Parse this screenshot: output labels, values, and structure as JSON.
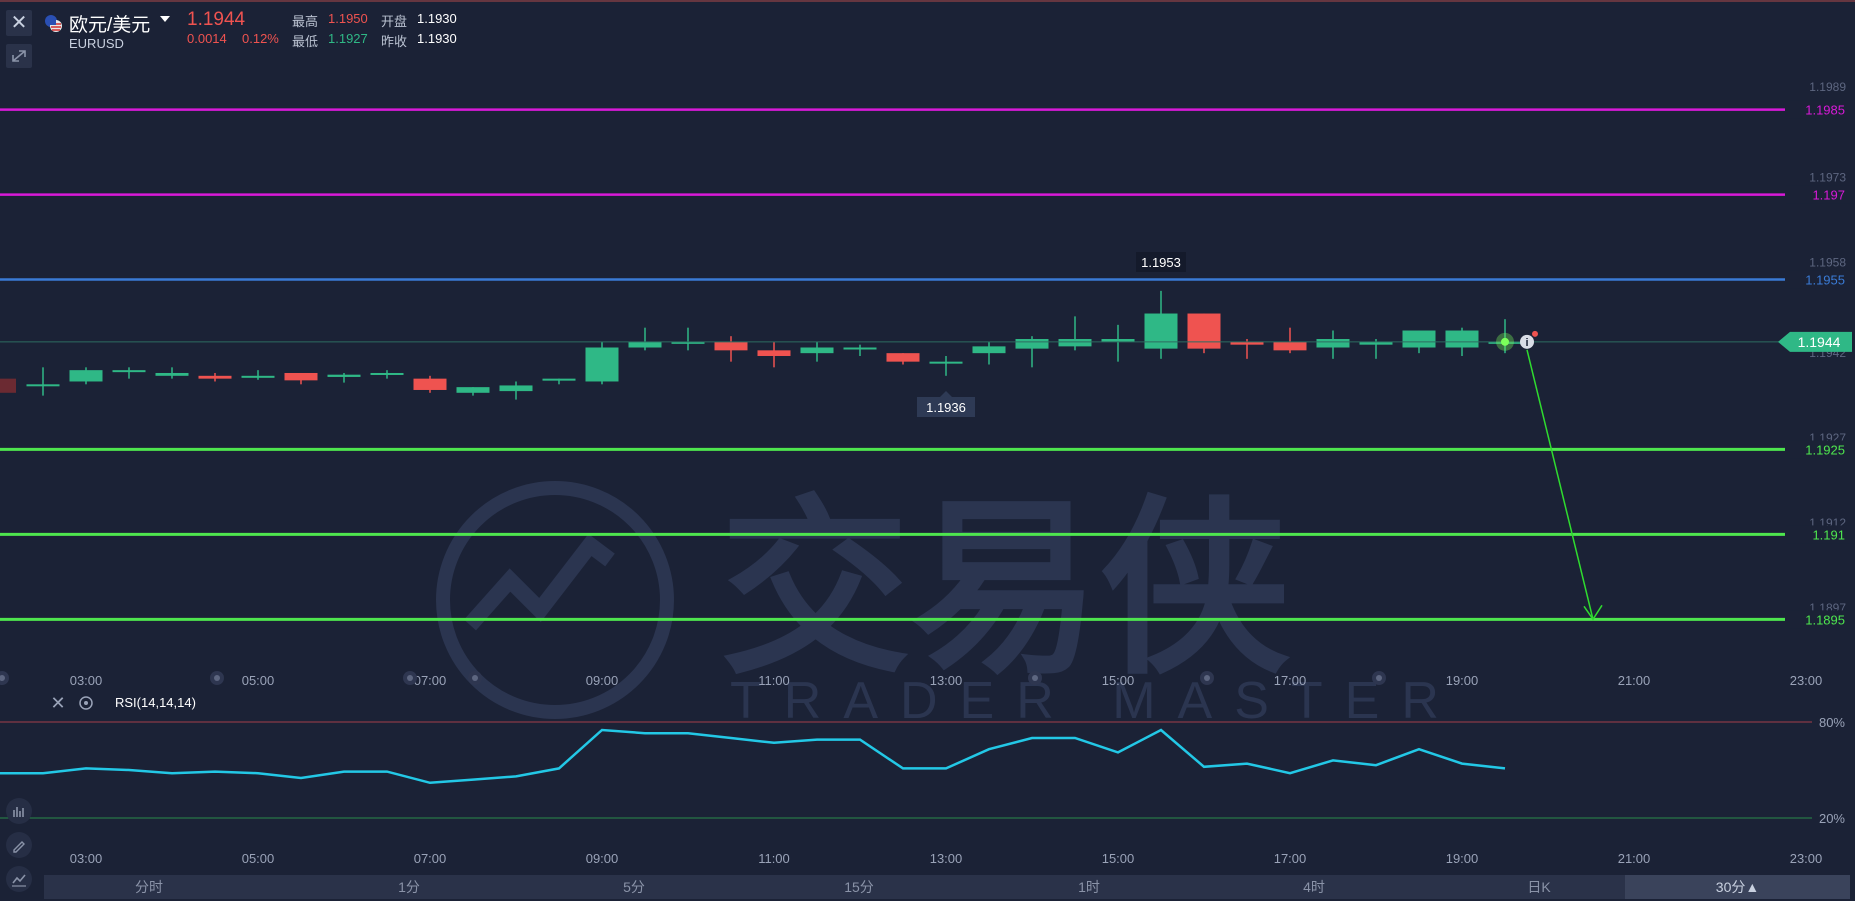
{
  "header": {
    "symbol_name": "欧元/美元",
    "symbol_code": "EURUSD",
    "last_price": "1.1944",
    "change": "0.0014",
    "change_pct": "0.12%",
    "high_label": "最高",
    "high_value": "1.1950",
    "open_label": "开盘",
    "open_value": "1.1930",
    "low_label": "最低",
    "low_value": "1.1927",
    "prev_close_label": "昨收",
    "prev_close_value": "1.1930"
  },
  "colors": {
    "background": "#1b2236",
    "up": "#2fb886",
    "down": "#ef5350",
    "magenta": "#d81ad8",
    "blue": "#3a7bd5",
    "green_line": "#4ee64e",
    "rsi": "#23c8e6"
  },
  "price_axis": {
    "ticks": [
      "1.1989",
      "1.1973",
      "1.1958",
      "1.1942",
      "1.1927",
      "1.1912",
      "1.1897"
    ]
  },
  "horizontal_lines": [
    {
      "price": 1.1985,
      "label": "1.1985",
      "color": "magenta"
    },
    {
      "price": 1.197,
      "label": "1.197",
      "color": "magenta"
    },
    {
      "price": 1.1955,
      "label": "1.1955",
      "color": "blue"
    },
    {
      "price": 1.1925,
      "label": "1.1925",
      "color": "green"
    },
    {
      "price": 1.191,
      "label": "1.191",
      "color": "green"
    },
    {
      "price": 1.1895,
      "label": "1.1895",
      "color": "green"
    }
  ],
  "current_price_tag": "1.1944",
  "annotations": {
    "high_marker": "1.1953",
    "low_marker": "1.1936"
  },
  "time_axis": [
    "03:00",
    "05:00",
    "07:00",
    "09:00",
    "11:00",
    "13:00",
    "15:00",
    "17:00",
    "19:00",
    "21:00",
    "23:00"
  ],
  "chart_data": {
    "type": "candlestick",
    "interval": "30分",
    "x_labels": [
      "03:00",
      "05:00",
      "07:00",
      "09:00",
      "11:00",
      "13:00",
      "15:00",
      "17:00",
      "19:00",
      "21:00",
      "23:00"
    ],
    "first_bar_time": "02:30",
    "candles": [
      {
        "o": 1.19365,
        "h": 1.19395,
        "l": 1.19345,
        "c": 1.19365
      },
      {
        "o": 1.1937,
        "h": 1.19395,
        "l": 1.19365,
        "c": 1.1939
      },
      {
        "o": 1.1939,
        "h": 1.19395,
        "l": 1.19375,
        "c": 1.1939
      },
      {
        "o": 1.1938,
        "h": 1.19395,
        "l": 1.19375,
        "c": 1.19385
      },
      {
        "o": 1.1938,
        "h": 1.19385,
        "l": 1.1937,
        "c": 1.19375
      },
      {
        "o": 1.1938,
        "h": 1.1939,
        "l": 1.19373,
        "c": 1.1938
      },
      {
        "o": 1.19385,
        "h": 1.19385,
        "l": 1.19365,
        "c": 1.19372
      },
      {
        "o": 1.19378,
        "h": 1.19385,
        "l": 1.19368,
        "c": 1.19382
      },
      {
        "o": 1.19385,
        "h": 1.1939,
        "l": 1.19375,
        "c": 1.19385
      },
      {
        "o": 1.19375,
        "h": 1.1938,
        "l": 1.1935,
        "c": 1.19355
      },
      {
        "o": 1.1935,
        "h": 1.1936,
        "l": 1.19345,
        "c": 1.1936
      },
      {
        "o": 1.19353,
        "h": 1.1937,
        "l": 1.19338,
        "c": 1.19363
      },
      {
        "o": 1.19375,
        "h": 1.19375,
        "l": 1.19365,
        "c": 1.19375
      },
      {
        "o": 1.1937,
        "h": 1.1944,
        "l": 1.19365,
        "c": 1.1943
      },
      {
        "o": 1.1943,
        "h": 1.19465,
        "l": 1.19425,
        "c": 1.1944
      },
      {
        "o": 1.1944,
        "h": 1.19465,
        "l": 1.19425,
        "c": 1.1944
      },
      {
        "o": 1.1944,
        "h": 1.1945,
        "l": 1.19405,
        "c": 1.19425
      },
      {
        "o": 1.19425,
        "h": 1.1944,
        "l": 1.19395,
        "c": 1.19415
      },
      {
        "o": 1.1942,
        "h": 1.1944,
        "l": 1.19405,
        "c": 1.1943
      },
      {
        "o": 1.1943,
        "h": 1.19435,
        "l": 1.19415,
        "c": 1.1943
      },
      {
        "o": 1.1942,
        "h": 1.1942,
        "l": 1.194,
        "c": 1.19405
      },
      {
        "o": 1.19405,
        "h": 1.19415,
        "l": 1.1938,
        "c": 1.19405
      },
      {
        "o": 1.1942,
        "h": 1.1944,
        "l": 1.194,
        "c": 1.19432
      },
      {
        "o": 1.19428,
        "h": 1.1945,
        "l": 1.19395,
        "c": 1.19445
      },
      {
        "o": 1.19432,
        "h": 1.19485,
        "l": 1.19425,
        "c": 1.19445
      },
      {
        "o": 1.1944,
        "h": 1.1947,
        "l": 1.19405,
        "c": 1.19445
      },
      {
        "o": 1.19428,
        "h": 1.1953,
        "l": 1.1941,
        "c": 1.1949
      },
      {
        "o": 1.1949,
        "h": 1.1949,
        "l": 1.1942,
        "c": 1.19428
      },
      {
        "o": 1.1944,
        "h": 1.19445,
        "l": 1.1941,
        "c": 1.19435
      },
      {
        "o": 1.1944,
        "h": 1.19465,
        "l": 1.1942,
        "c": 1.19425
      },
      {
        "o": 1.1943,
        "h": 1.1946,
        "l": 1.1941,
        "c": 1.19445
      },
      {
        "o": 1.19435,
        "h": 1.19445,
        "l": 1.1941,
        "c": 1.1944
      },
      {
        "o": 1.1943,
        "h": 1.1946,
        "l": 1.1942,
        "c": 1.1946
      },
      {
        "o": 1.1943,
        "h": 1.19465,
        "l": 1.19415,
        "c": 1.1946
      },
      {
        "o": 1.1944,
        "h": 1.1948,
        "l": 1.1942,
        "c": 1.1944
      }
    ],
    "projection": {
      "from_price": 1.1944,
      "to_price": 1.1895
    }
  },
  "rsi_panel": {
    "label": "RSI(14,14,14)",
    "level_high": "80%",
    "level_low": "20%",
    "values": [
      48,
      48,
      51,
      50,
      48,
      49,
      48,
      45,
      49,
      49,
      42,
      44,
      46,
      51,
      75,
      73,
      73,
      70,
      67,
      69,
      69,
      51,
      51,
      63,
      70,
      70,
      61,
      75,
      52,
      54,
      48,
      56,
      53,
      63,
      54,
      51
    ]
  },
  "timeframes": [
    "分时",
    "1分",
    "5分",
    "15分",
    "1时",
    "4时",
    "日K",
    "30分▲"
  ],
  "watermark": {
    "brand_cn": "交易侠",
    "brand_en": "TRADER MASTER"
  }
}
